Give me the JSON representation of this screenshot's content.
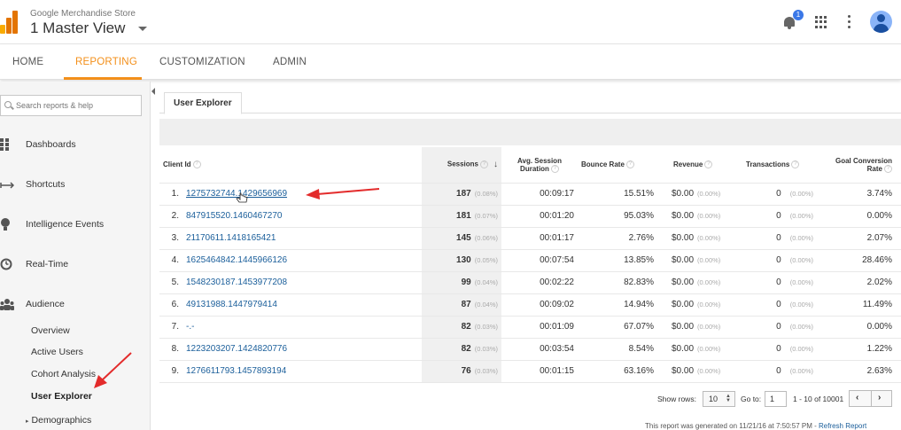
{
  "header": {
    "store_name": "Google Merchandise Store",
    "view_name": "1 Master View",
    "notification_count": "1"
  },
  "nav": {
    "tabs": [
      {
        "label": "HOME"
      },
      {
        "label": "REPORTING"
      },
      {
        "label": "CUSTOMIZATION"
      },
      {
        "label": "ADMIN"
      }
    ],
    "active": "REPORTING"
  },
  "sidebar": {
    "search_placeholder": "Search reports & help",
    "items": [
      {
        "label": "Dashboards"
      },
      {
        "label": "Shortcuts"
      },
      {
        "label": "Intelligence Events"
      },
      {
        "label": "Real-Time"
      },
      {
        "label": "Audience"
      }
    ],
    "audience_items": [
      {
        "label": "Overview"
      },
      {
        "label": "Active Users"
      },
      {
        "label": "Cohort Analysis"
      },
      {
        "label": "User Explorer"
      },
      {
        "label": "Demographics"
      }
    ]
  },
  "report": {
    "tab": "User Explorer",
    "columns": {
      "client_id": "Client Id",
      "sessions": "Sessions",
      "avg_session_duration_1": "Avg. Session",
      "avg_session_duration_2": "Duration",
      "bounce_rate": "Bounce Rate",
      "revenue": "Revenue",
      "transactions": "Transactions",
      "goal_conversion_rate_1": "Goal Conversion",
      "goal_conversion_rate_2": "Rate"
    },
    "rows": [
      {
        "n": "1.",
        "client_id": "1275732744.1429656969",
        "sessions": "187",
        "sessions_pct": "(0.08%)",
        "duration": "00:09:17",
        "bounce": "15.51%",
        "revenue": "$0.00",
        "revenue_pct": "(0.00%)",
        "transactions": "0",
        "transactions_pct": "(0.00%)",
        "goal": "3.74%"
      },
      {
        "n": "2.",
        "client_id": "847915520.1460467270",
        "sessions": "181",
        "sessions_pct": "(0.07%)",
        "duration": "00:01:20",
        "bounce": "95.03%",
        "revenue": "$0.00",
        "revenue_pct": "(0.00%)",
        "transactions": "0",
        "transactions_pct": "(0.00%)",
        "goal": "0.00%"
      },
      {
        "n": "3.",
        "client_id": "21170611.1418165421",
        "sessions": "145",
        "sessions_pct": "(0.06%)",
        "duration": "00:01:17",
        "bounce": "2.76%",
        "revenue": "$0.00",
        "revenue_pct": "(0.00%)",
        "transactions": "0",
        "transactions_pct": "(0.00%)",
        "goal": "2.07%"
      },
      {
        "n": "4.",
        "client_id": "1625464842.1445966126",
        "sessions": "130",
        "sessions_pct": "(0.05%)",
        "duration": "00:07:54",
        "bounce": "13.85%",
        "revenue": "$0.00",
        "revenue_pct": "(0.00%)",
        "transactions": "0",
        "transactions_pct": "(0.00%)",
        "goal": "28.46%"
      },
      {
        "n": "5.",
        "client_id": "1548230187.1453977208",
        "sessions": "99",
        "sessions_pct": "(0.04%)",
        "duration": "00:02:22",
        "bounce": "82.83%",
        "revenue": "$0.00",
        "revenue_pct": "(0.00%)",
        "transactions": "0",
        "transactions_pct": "(0.00%)",
        "goal": "2.02%"
      },
      {
        "n": "6.",
        "client_id": "49131988.1447979414",
        "sessions": "87",
        "sessions_pct": "(0.04%)",
        "duration": "00:09:02",
        "bounce": "14.94%",
        "revenue": "$0.00",
        "revenue_pct": "(0.00%)",
        "transactions": "0",
        "transactions_pct": "(0.00%)",
        "goal": "11.49%"
      },
      {
        "n": "7.",
        "client_id": "-.-",
        "sessions": "82",
        "sessions_pct": "(0.03%)",
        "duration": "00:01:09",
        "bounce": "67.07%",
        "revenue": "$0.00",
        "revenue_pct": "(0.00%)",
        "transactions": "0",
        "transactions_pct": "(0.00%)",
        "goal": "0.00%"
      },
      {
        "n": "8.",
        "client_id": "1223203207.1424820776",
        "sessions": "82",
        "sessions_pct": "(0.03%)",
        "duration": "00:03:54",
        "bounce": "8.54%",
        "revenue": "$0.00",
        "revenue_pct": "(0.00%)",
        "transactions": "0",
        "transactions_pct": "(0.00%)",
        "goal": "1.22%"
      },
      {
        "n": "9.",
        "client_id": "1276611793.1457893194",
        "sessions": "76",
        "sessions_pct": "(0.03%)",
        "duration": "00:01:15",
        "bounce": "63.16%",
        "revenue": "$0.00",
        "revenue_pct": "(0.00%)",
        "transactions": "0",
        "transactions_pct": "(0.00%)",
        "goal": "2.63%"
      }
    ],
    "footer": {
      "show_rows_label": "Show rows:",
      "show_rows_value": "10",
      "goto_label": "Go to:",
      "goto_value": "1",
      "range": "1 - 10 of 10001",
      "note": "This report was generated on 11/21/16 at 7:50:57 PM - ",
      "refresh": "Refresh Report"
    }
  },
  "colors": {
    "accent": "#f38f1a",
    "link": "#1a5e9a",
    "annotation_arrow": "#e32b2b",
    "logo_bars": [
      "#f9ab00",
      "#e37400",
      "#e37400"
    ]
  }
}
